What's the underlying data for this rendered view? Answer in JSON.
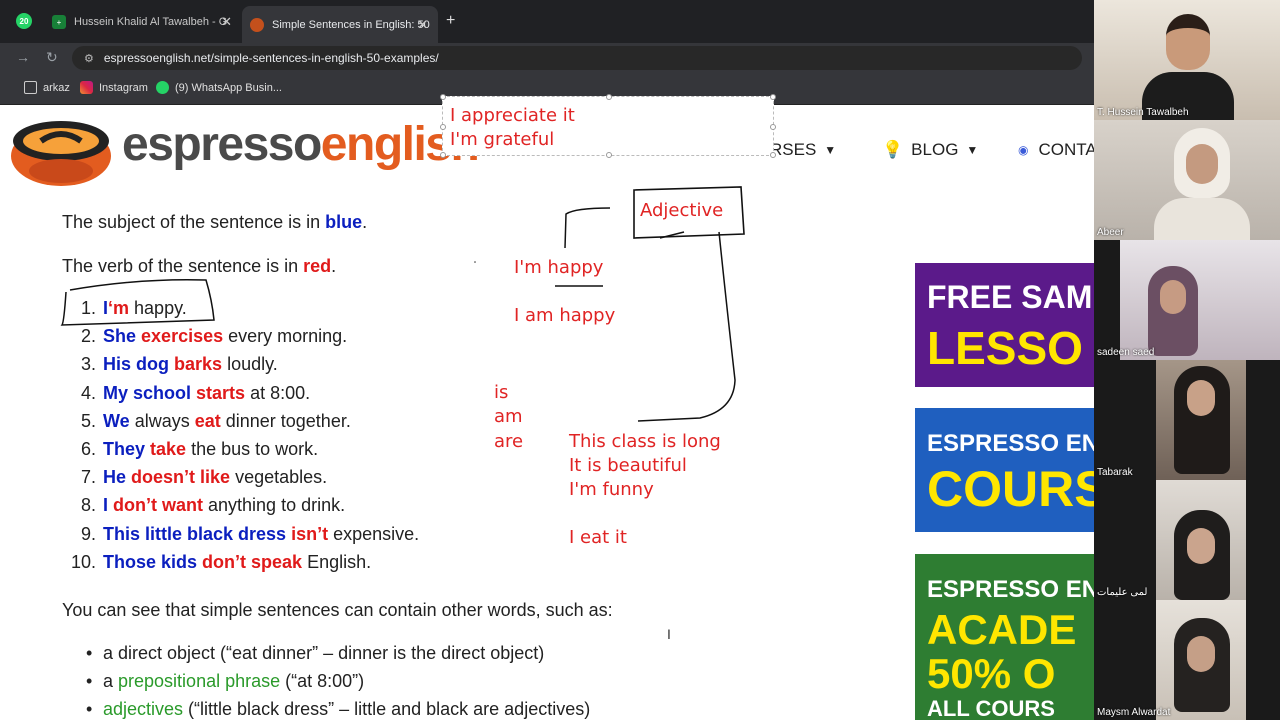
{
  "browser": {
    "tabs": [
      {
        "label": "Hussein Khalid Al Tawalbeh - G",
        "active": false,
        "icon": "sheets-icon"
      },
      {
        "label": "Simple Sentences in English: 50",
        "active": true,
        "icon": "espresso-favicon"
      }
    ],
    "whatsapp_tab_badge": "20",
    "url": "espressoenglish.net/simple-sentences-in-english-50-examples/",
    "bookmarks": [
      {
        "label": "arkaz",
        "icon": "folder-icon"
      },
      {
        "label": "Instagram",
        "icon": "instagram-icon"
      },
      {
        "label": "(9) WhatsApp Busin...",
        "icon": "whatsapp-icon"
      }
    ]
  },
  "site": {
    "logo_part1": "espresso",
    "logo_part2": "english",
    "nav": [
      {
        "label": "RSES",
        "icon": ""
      },
      {
        "label": "BLOG",
        "icon": "lightbulb-icon"
      },
      {
        "label": "CONTA",
        "icon": "contact-icon"
      }
    ]
  },
  "article": {
    "subject_intro": "The subject of the sentence is in ",
    "subject_color_word": "blue",
    "verb_intro": "The verb of the sentence is in ",
    "verb_color_word": "red",
    "period": ".",
    "examples": [
      {
        "num": "1.",
        "parts": [
          {
            "t": "I",
            "c": "blue"
          },
          {
            "t": "‘m",
            "c": "red"
          },
          {
            "t": " happy.",
            "c": ""
          }
        ]
      },
      {
        "num": "2.",
        "parts": [
          {
            "t": "She",
            "c": "blue"
          },
          {
            "t": " ",
            "c": ""
          },
          {
            "t": "exercises",
            "c": "red"
          },
          {
            "t": " every morning.",
            "c": ""
          }
        ]
      },
      {
        "num": "3.",
        "parts": [
          {
            "t": "His dog",
            "c": "blue"
          },
          {
            "t": " ",
            "c": ""
          },
          {
            "t": "barks",
            "c": "red"
          },
          {
            "t": " loudly.",
            "c": ""
          }
        ]
      },
      {
        "num": "4.",
        "parts": [
          {
            "t": "My school",
            "c": "blue"
          },
          {
            "t": " ",
            "c": ""
          },
          {
            "t": "starts",
            "c": "red"
          },
          {
            "t": " at 8:00.",
            "c": ""
          }
        ]
      },
      {
        "num": "5.",
        "parts": [
          {
            "t": "We",
            "c": "blue"
          },
          {
            "t": " always ",
            "c": ""
          },
          {
            "t": "eat",
            "c": "red"
          },
          {
            "t": " dinner together.",
            "c": ""
          }
        ]
      },
      {
        "num": "6.",
        "parts": [
          {
            "t": "They",
            "c": "blue"
          },
          {
            "t": " ",
            "c": ""
          },
          {
            "t": "take",
            "c": "red"
          },
          {
            "t": " the bus to work.",
            "c": ""
          }
        ]
      },
      {
        "num": "7.",
        "parts": [
          {
            "t": "He",
            "c": "blue"
          },
          {
            "t": " ",
            "c": ""
          },
          {
            "t": "doesn’t like",
            "c": "red"
          },
          {
            "t": " vegetables.",
            "c": ""
          }
        ]
      },
      {
        "num": "8.",
        "parts": [
          {
            "t": "I",
            "c": "blue"
          },
          {
            "t": " ",
            "c": ""
          },
          {
            "t": "don’t want",
            "c": "red"
          },
          {
            "t": " anything to drink.",
            "c": ""
          }
        ]
      },
      {
        "num": "9.",
        "parts": [
          {
            "t": "This little black dress",
            "c": "blue"
          },
          {
            "t": " ",
            "c": ""
          },
          {
            "t": "isn’t",
            "c": "red"
          },
          {
            "t": " expensive.",
            "c": ""
          }
        ]
      },
      {
        "num": "10.",
        "parts": [
          {
            "t": "Those kids",
            "c": "blue"
          },
          {
            "t": " ",
            "c": ""
          },
          {
            "t": "don’t speak",
            "c": "red"
          },
          {
            "t": " English.",
            "c": ""
          }
        ]
      }
    ],
    "other_words_intro": "You can see that simple sentences can contain other words, such as:",
    "bullets": [
      {
        "parts": [
          {
            "t": "a direct object (“eat dinner” – dinner is the direct object)",
            "c": ""
          }
        ]
      },
      {
        "parts": [
          {
            "t": "a ",
            "c": ""
          },
          {
            "t": "prepositional phrase",
            "c": "green"
          },
          {
            "t": " (“at 8:00”)",
            "c": ""
          }
        ]
      },
      {
        "parts": [
          {
            "t": "adjectives",
            "c": "green"
          },
          {
            "t": " (“little black dress” – little and black are adjectives)",
            "c": ""
          }
        ]
      }
    ]
  },
  "annotations": {
    "textbox_line1": "I appreciate it",
    "textbox_line2": "I'm grateful",
    "adjective": "Adjective",
    "im_happy": "I'm happy",
    "i_am_happy": "I am happy",
    "is": "is",
    "am": "am",
    "are": "are",
    "class_long": "This class is long",
    "beautiful": "It is beautiful",
    "funny": "I'm funny",
    "eat_it": "I eat it"
  },
  "ads": [
    {
      "line1": "FREE SAM",
      "line2": "LESSO",
      "bg": "#5b1a8a"
    },
    {
      "line1": "ESPRESSO EN",
      "line2": "COURS",
      "bg": "#1f5fbf"
    },
    {
      "line1": "ESPRESSO EN",
      "line2": "ACADE",
      "line3": "50% O",
      "line4": "ALL COURS",
      "bg": "#2e7d32"
    }
  ],
  "participants": [
    {
      "name": "T. Hussein Tawalbeh",
      "bg": "#d9cfc2"
    },
    {
      "name": "Abeer",
      "bg": "#cfc8c0"
    },
    {
      "name": "sadeen saed",
      "bg": "#c9c0c6"
    },
    {
      "name": "Tabarak",
      "bg": "#8d8178"
    },
    {
      "name": "لمى عليمات",
      "bg": "#c6bfb8"
    },
    {
      "name": "Maysm Alwardat",
      "bg": "#d2cbc3"
    }
  ],
  "colors": {
    "subject_blue": "#0b1fbf",
    "verb_red": "#e01a1a",
    "annotation_red": "#e02424",
    "logo_orange": "#e35c1f"
  }
}
